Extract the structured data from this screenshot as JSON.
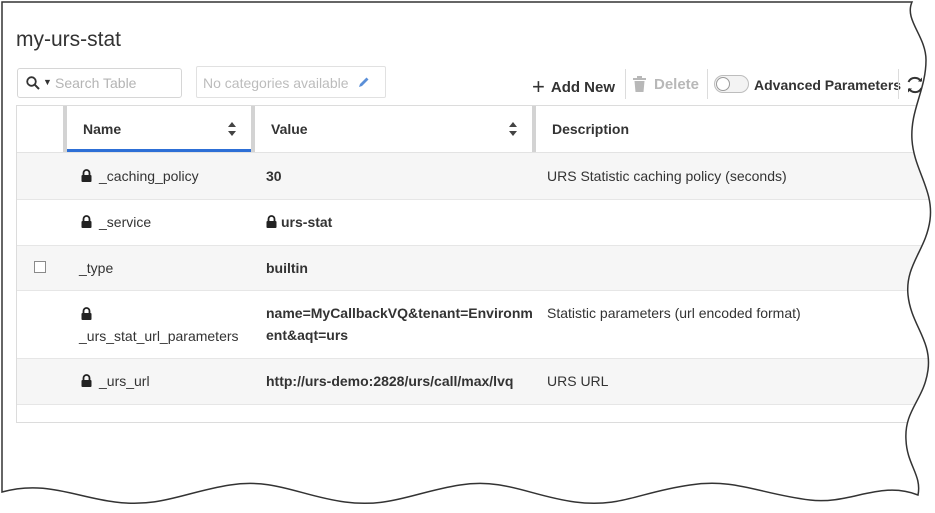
{
  "page": {
    "title": "my-urs-stat"
  },
  "toolbar": {
    "search_placeholder": "Search Table",
    "categories_text": "No categories available",
    "add_new_label": "Add New",
    "delete_label": "Delete",
    "advanced_label": "Advanced Parameters",
    "advanced_enabled": false
  },
  "table": {
    "columns": [
      "Name",
      "Value",
      "Description"
    ],
    "rows": [
      {
        "name": "_caching_policy",
        "locked": true,
        "value": "30",
        "value_locked": false,
        "description": "URS Statistic caching policy (seconds)"
      },
      {
        "name": "_service",
        "locked": true,
        "value": "urs-stat",
        "value_locked": true,
        "description": ""
      },
      {
        "name": "_type",
        "locked": false,
        "checkbox": true,
        "value": "builtin",
        "value_locked": false,
        "description": ""
      },
      {
        "name": "_urs_stat_url_parameters",
        "locked": true,
        "value_line1": "name=MyCallbackVQ&tenant=Environm",
        "value_line2": "ent&aqt=urs",
        "value_locked": false,
        "description": "Statistic parameters (url encoded format)"
      },
      {
        "name": "_urs_url",
        "locked": true,
        "value": "http://urs-demo:2828/urs/call/max/lvq",
        "value_locked": false,
        "description": "URS URL"
      }
    ]
  },
  "colors": {
    "accent": "#2d6fd6",
    "disabled": "#b8b8b8"
  },
  "icons": [
    "search-icon",
    "chevron-down-icon",
    "pencil-icon",
    "plus-icon",
    "trash-icon",
    "refresh-icon",
    "sort-icon",
    "lock-icon"
  ]
}
